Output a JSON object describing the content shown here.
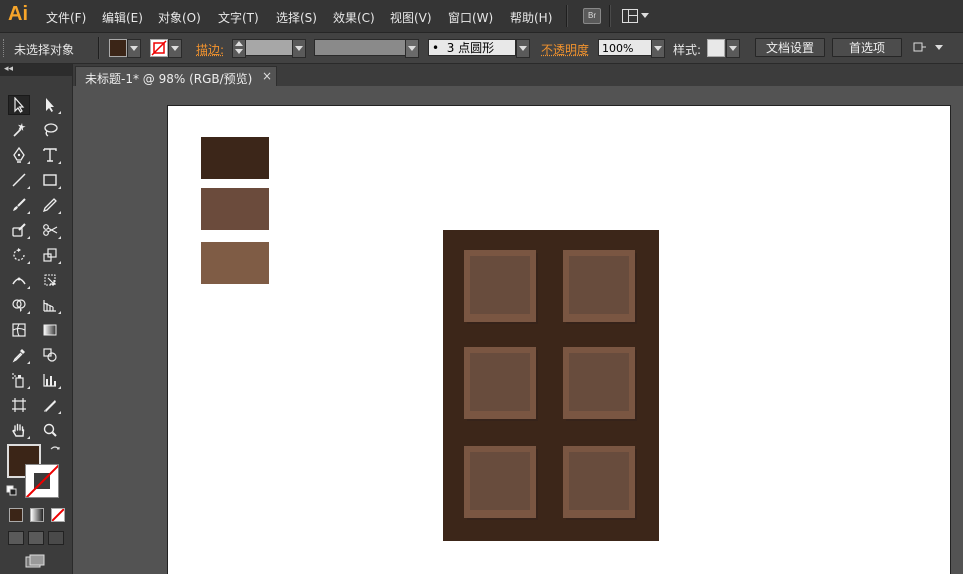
{
  "app": {
    "logo": "Ai"
  },
  "menu": [
    "文件(F)",
    "编辑(E)",
    "对象(O)",
    "文字(T)",
    "选择(S)",
    "效果(C)",
    "视图(V)",
    "窗口(W)",
    "帮助(H)"
  ],
  "menu_extra": {
    "bridge_label": "Br"
  },
  "control": {
    "selection_status": "未选择对象",
    "stroke_label": "描边:",
    "brush_dot": "•",
    "brush_value": "3 点圆形",
    "opacity_label": "不透明度",
    "opacity_value": "100%",
    "style_label": "样式:",
    "doc_setup_button": "文档设置",
    "preferences_button": "首选项"
  },
  "document_tab": {
    "title": "未标题-1* @ 98% (RGB/预览)",
    "close": "×"
  },
  "toolbar": {
    "collapse": "◂◂",
    "fill_color": "#3b2517",
    "stroke": "none"
  },
  "artwork": {
    "swatches": [
      "#3c2619",
      "#6b4b3c",
      "#7f5c45"
    ],
    "bar_color": "#3c2619",
    "piece_face": "#684c3d",
    "piece_highlight": "#7a5642",
    "piece_count": 6
  },
  "colors": {
    "accent_orange": "#f2932e",
    "logo_orange": "#f7a52a"
  }
}
